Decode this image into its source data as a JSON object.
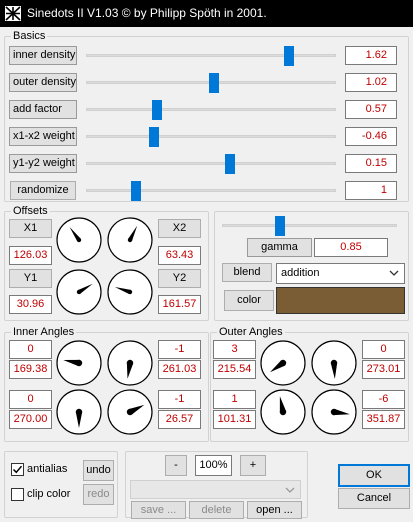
{
  "window": {
    "title": "Sinedots II V1.03 © by Philipp Spöth in 2001."
  },
  "basics": {
    "label": "Basics",
    "rows": [
      {
        "label": "inner density",
        "value": "1.62",
        "pos": 0.81
      },
      {
        "label": "outer density",
        "value": "1.02",
        "pos": 0.51
      },
      {
        "label": "add factor",
        "value": "0.57",
        "pos": 0.285
      },
      {
        "label": "x1-x2 weight",
        "value": "-0.46",
        "pos": 0.27
      },
      {
        "label": "y1-y2 weight",
        "value": "0.15",
        "pos": 0.575
      },
      {
        "label": "randomize",
        "value": "1",
        "pos": 0.2
      }
    ]
  },
  "offsets": {
    "label": "Offsets",
    "x1_label": "X1",
    "x1_value": "126.03",
    "x2_label": "X2",
    "x2_value": "63.43",
    "y1_label": "Y1",
    "y1_value": "30.96",
    "y2_label": "Y2",
    "y2_value": "161.57",
    "dials": [
      126.03,
      63.43,
      30.96,
      161.57
    ]
  },
  "gamma": {
    "label": "gamma",
    "value": "0.85",
    "pos": 0.33
  },
  "blend": {
    "label": "blend",
    "selected": "addition"
  },
  "color": {
    "label": "color",
    "swatch": "#7a5c35"
  },
  "inner_angles": {
    "label": "Inner Angles",
    "items": [
      {
        "turns": "0",
        "angle": "169.38"
      },
      {
        "turns": "-1",
        "angle": "261.03"
      },
      {
        "turns": "0",
        "angle": "270.00"
      },
      {
        "turns": "-1",
        "angle": "26.57"
      }
    ]
  },
  "outer_angles": {
    "label": "Outer Angles",
    "items": [
      {
        "turns": "3",
        "angle": "215.54"
      },
      {
        "turns": "0",
        "angle": "273.01"
      },
      {
        "turns": "1",
        "angle": "101.31"
      },
      {
        "turns": "-6",
        "angle": "351.87"
      }
    ]
  },
  "options": {
    "antialias_label": "antialias",
    "antialias_checked": true,
    "clip_color_label": "clip color",
    "clip_color_checked": false,
    "undo_label": "undo",
    "redo_label": "redo"
  },
  "presets": {
    "minus_label": "-",
    "zoom": "100%",
    "plus_label": "+",
    "save_label": "save ...",
    "delete_label": "delete",
    "open_label": "open ..."
  },
  "dialog": {
    "ok_label": "OK",
    "cancel_label": "Cancel"
  },
  "colors": {
    "accent": "#0078d7",
    "value_red": "#c00000",
    "titlebar": "#000000"
  }
}
